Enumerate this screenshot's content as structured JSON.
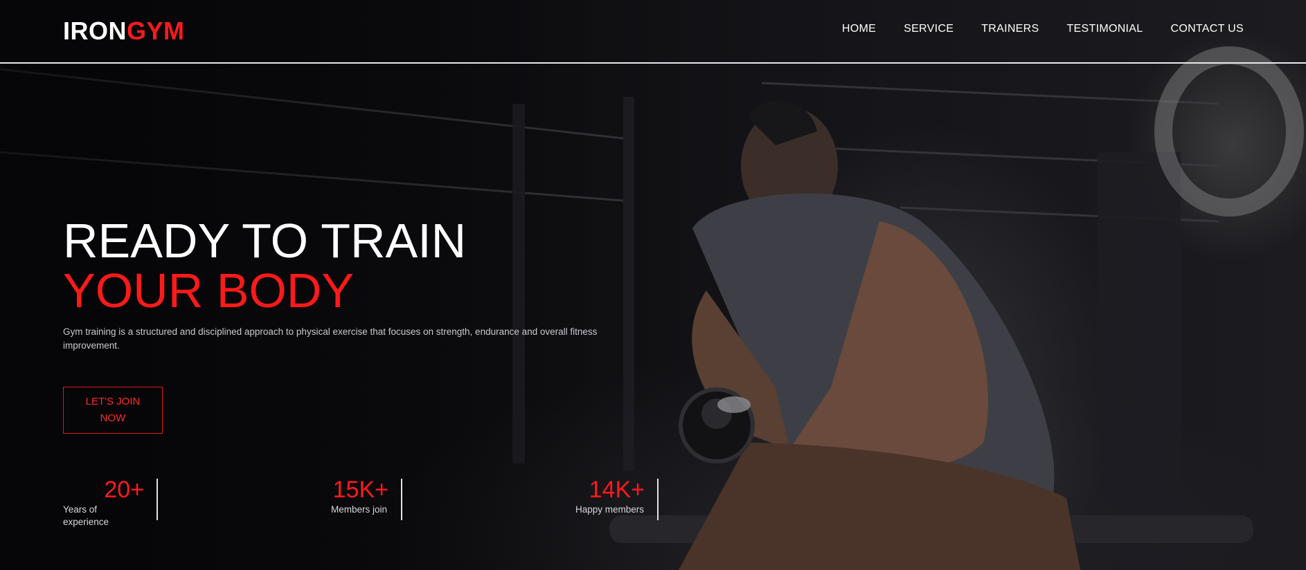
{
  "brand": {
    "part1": "IRON",
    "part2": "GYM"
  },
  "nav": {
    "items": [
      "HOME",
      "SERVICE",
      "TRAINERS",
      "TESTIMONIAL",
      "CONTACT US"
    ]
  },
  "hero": {
    "title_line1": "READY TO TRAIN",
    "title_line2": "YOUR BODY",
    "description": "Gym training is a structured and disciplined approach to physical exercise that focuses on strength, endurance and overall fitness improvement.",
    "cta_label": "LET'S JOIN NOW"
  },
  "stats": [
    {
      "value": "20+",
      "label": "Years of experience"
    },
    {
      "value": "15K+",
      "label": "Members join"
    },
    {
      "value": "14K+",
      "label": "Happy members"
    }
  ],
  "colors": {
    "accent": "#ff1a1a",
    "background": "#0b0b0d",
    "text": "#ffffff"
  }
}
